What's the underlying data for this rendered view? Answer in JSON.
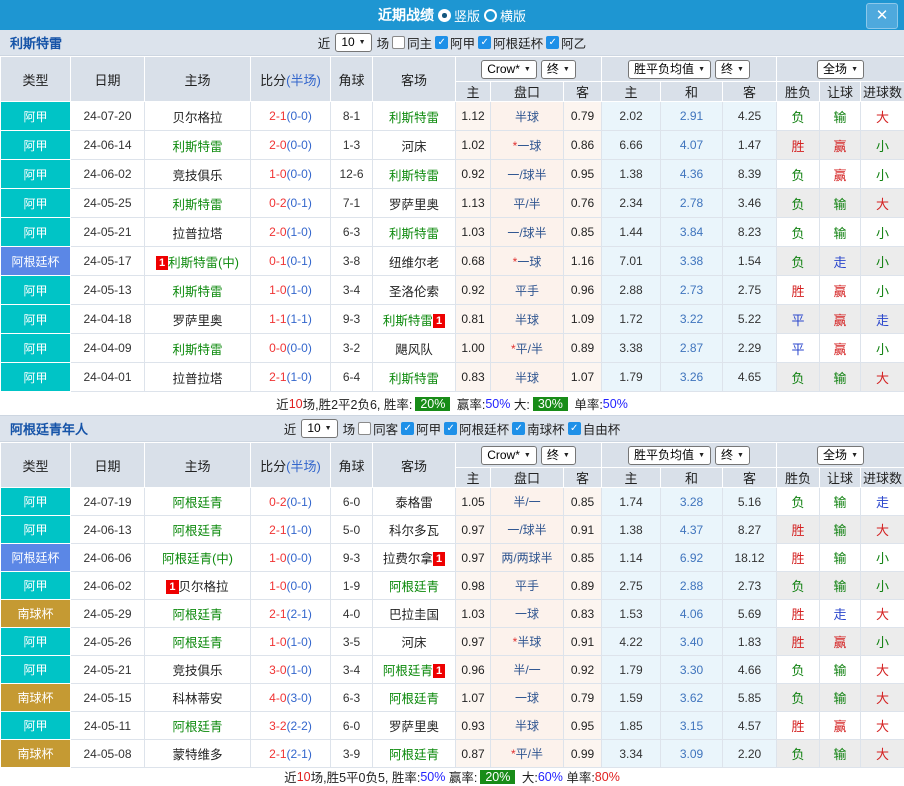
{
  "topbar": {
    "title": "近期战绩",
    "radios": [
      {
        "label": "竖版",
        "selected": true
      },
      {
        "label": "横版",
        "selected": false
      }
    ],
    "close_glyph": "✕"
  },
  "header": {
    "left": [
      "类型",
      "日期",
      "主场",
      "比分",
      "角球",
      "客场"
    ],
    "score_suffix": "(半场)",
    "subs": [
      "主",
      "盘口",
      "客",
      "主",
      "和",
      "客",
      "胜负",
      "让球",
      "进球数"
    ],
    "groups": [
      [
        "Crow*",
        "终"
      ],
      [
        "胜平负均值",
        "终"
      ],
      [
        "全场"
      ]
    ]
  },
  "colors": {
    "topbar_blue": "#1e96d2",
    "league_cyan": "#00c4c6",
    "league_blue": "#5b87e6",
    "league_gold": "#c59a33",
    "badge_green": "#188c18",
    "badge_red": "#ee0000"
  },
  "sections": [
    {
      "team": "利斯特雷",
      "filter": {
        "near": "近",
        "count": "10",
        "unit": "场",
        "checks": [
          {
            "label": "同主",
            "checked": false
          },
          {
            "label": "阿甲",
            "checked": true
          },
          {
            "label": "阿根廷杯",
            "checked": true
          },
          {
            "label": "阿乙",
            "checked": true
          }
        ]
      },
      "rows": [
        {
          "type": "阿甲",
          "tc": "cyan",
          "date": "24-07-20",
          "home": {
            "n": "贝尔格拉"
          },
          "score": "2-1",
          "half": "(0-0)",
          "corner": "8-1",
          "away": {
            "n": "利斯特雷",
            "g": true
          },
          "oh": "1.12",
          "star": false,
          "hc": "半球",
          "oa": "0.79",
          "ah": "2.02",
          "ad": "2.91",
          "aa": "4.25",
          "res": [
            [
              "负",
              "g"
            ],
            [
              "输",
              "g"
            ],
            [
              "大",
              "r"
            ]
          ]
        },
        {
          "type": "阿甲",
          "tc": "cyan",
          "date": "24-06-14",
          "home": {
            "n": "利斯特雷",
            "g": true
          },
          "score": "2-0",
          "half": "(0-0)",
          "corner": "1-3",
          "away": {
            "n": "河床"
          },
          "oh": "1.02",
          "star": true,
          "hc": "一球",
          "oa": "0.86",
          "ah": "6.66",
          "ad": "4.07",
          "aa": "1.47",
          "res": [
            [
              "胜",
              "r"
            ],
            [
              "赢",
              "r"
            ],
            [
              "小",
              "g"
            ]
          ]
        },
        {
          "type": "阿甲",
          "tc": "cyan",
          "date": "24-06-02",
          "home": {
            "n": "竞技俱乐"
          },
          "score": "1-0",
          "half": "(0-0)",
          "corner": "12-6",
          "away": {
            "n": "利斯特雷",
            "g": true
          },
          "oh": "0.92",
          "star": false,
          "hc": "一/球半",
          "oa": "0.95",
          "ah": "1.38",
          "ad": "4.36",
          "aa": "8.39",
          "res": [
            [
              "负",
              "g"
            ],
            [
              "赢",
              "r"
            ],
            [
              "小",
              "g"
            ]
          ]
        },
        {
          "type": "阿甲",
          "tc": "cyan",
          "date": "24-05-25",
          "home": {
            "n": "利斯特雷",
            "g": true
          },
          "score": "0-2",
          "half": "(0-1)",
          "corner": "7-1",
          "away": {
            "n": "罗萨里奥"
          },
          "oh": "1.13",
          "star": false,
          "hc": "平/半",
          "oa": "0.76",
          "ah": "2.34",
          "ad": "2.78",
          "aa": "3.46",
          "res": [
            [
              "负",
              "g"
            ],
            [
              "输",
              "g"
            ],
            [
              "大",
              "r"
            ]
          ]
        },
        {
          "type": "阿甲",
          "tc": "cyan",
          "date": "24-05-21",
          "home": {
            "n": "拉普拉塔"
          },
          "score": "2-0",
          "half": "(1-0)",
          "corner": "6-3",
          "away": {
            "n": "利斯特雷",
            "g": true
          },
          "oh": "1.03",
          "star": false,
          "hc": "一/球半",
          "oa": "0.85",
          "ah": "1.44",
          "ad": "3.84",
          "aa": "8.23",
          "res": [
            [
              "负",
              "g"
            ],
            [
              "输",
              "g"
            ],
            [
              "小",
              "g"
            ]
          ]
        },
        {
          "type": "阿根廷杯",
          "tc": "blue",
          "date": "24-05-17",
          "home": {
            "n": "利斯特雷(中)",
            "g": true,
            "b": "before"
          },
          "score": "0-1",
          "half": "(0-1)",
          "corner": "3-8",
          "away": {
            "n": "纽维尔老"
          },
          "oh": "0.68",
          "star": true,
          "hc": "一球",
          "oa": "1.16",
          "ah": "7.01",
          "ad": "3.38",
          "aa": "1.54",
          "res": [
            [
              "负",
              "g"
            ],
            [
              "走",
              "b"
            ],
            [
              "小",
              "g"
            ]
          ]
        },
        {
          "type": "阿甲",
          "tc": "cyan",
          "date": "24-05-13",
          "home": {
            "n": "利斯特雷",
            "g": true
          },
          "score": "1-0",
          "half": "(1-0)",
          "corner": "3-4",
          "away": {
            "n": "圣洛伦索"
          },
          "oh": "0.92",
          "star": false,
          "hc": "平手",
          "oa": "0.96",
          "ah": "2.88",
          "ad": "2.73",
          "aa": "2.75",
          "res": [
            [
              "胜",
              "r"
            ],
            [
              "赢",
              "r"
            ],
            [
              "小",
              "g"
            ]
          ]
        },
        {
          "type": "阿甲",
          "tc": "cyan",
          "date": "24-04-18",
          "home": {
            "n": "罗萨里奥"
          },
          "score": "1-1",
          "half": "(1-1)",
          "corner": "9-3",
          "away": {
            "n": "利斯特雷",
            "g": true,
            "b": "after"
          },
          "oh": "0.81",
          "star": false,
          "hc": "半球",
          "oa": "1.09",
          "ah": "1.72",
          "ad": "3.22",
          "aa": "5.22",
          "res": [
            [
              "平",
              "b"
            ],
            [
              "赢",
              "r"
            ],
            [
              "走",
              "b"
            ]
          ]
        },
        {
          "type": "阿甲",
          "tc": "cyan",
          "date": "24-04-09",
          "home": {
            "n": "利斯特雷",
            "g": true
          },
          "score": "0-0",
          "half": "(0-0)",
          "corner": "3-2",
          "away": {
            "n": "飓风队"
          },
          "oh": "1.00",
          "star": true,
          "hc": "平/半",
          "oa": "0.89",
          "ah": "3.38",
          "ad": "2.87",
          "aa": "2.29",
          "res": [
            [
              "平",
              "b"
            ],
            [
              "赢",
              "r"
            ],
            [
              "小",
              "g"
            ]
          ]
        },
        {
          "type": "阿甲",
          "tc": "cyan",
          "date": "24-04-01",
          "home": {
            "n": "拉普拉塔"
          },
          "score": "2-1",
          "half": "(1-0)",
          "corner": "6-4",
          "away": {
            "n": "利斯特雷",
            "g": true
          },
          "oh": "0.83",
          "star": false,
          "hc": "半球",
          "oa": "1.07",
          "ah": "1.79",
          "ad": "3.26",
          "aa": "4.65",
          "res": [
            [
              "负",
              "g"
            ],
            [
              "输",
              "g"
            ],
            [
              "大",
              "r"
            ]
          ]
        }
      ],
      "summary": [
        {
          "t": "近"
        },
        {
          "t": "10",
          "s": "red"
        },
        {
          "t": "场,胜2平2负6, 胜率:"
        },
        {
          "t": "20%",
          "s": "badge"
        },
        {
          "t": " 赢率:"
        },
        {
          "t": "50%",
          "s": "blue"
        },
        {
          "t": " 大:"
        },
        {
          "t": "30%",
          "s": "badge"
        },
        {
          "t": " 单率:"
        },
        {
          "t": "50%",
          "s": "blue"
        }
      ]
    },
    {
      "team": "阿根廷青年人",
      "filter": {
        "near": "近",
        "count": "10",
        "unit": "场",
        "checks": [
          {
            "label": "同客",
            "checked": false
          },
          {
            "label": "阿甲",
            "checked": true
          },
          {
            "label": "阿根廷杯",
            "checked": true
          },
          {
            "label": "南球杯",
            "checked": true
          },
          {
            "label": "自由杯",
            "checked": true
          }
        ]
      },
      "rows": [
        {
          "type": "阿甲",
          "tc": "cyan",
          "date": "24-07-19",
          "home": {
            "n": "阿根廷青",
            "g": true
          },
          "score": "0-2",
          "half": "(0-1)",
          "corner": "6-0",
          "away": {
            "n": "泰格雷"
          },
          "oh": "1.05",
          "star": false,
          "hc": "半/一",
          "oa": "0.85",
          "ah": "1.74",
          "ad": "3.28",
          "aa": "5.16",
          "res": [
            [
              "负",
              "g"
            ],
            [
              "输",
              "g"
            ],
            [
              "走",
              "b"
            ]
          ]
        },
        {
          "type": "阿甲",
          "tc": "cyan",
          "date": "24-06-13",
          "home": {
            "n": "阿根廷青",
            "g": true
          },
          "score": "2-1",
          "half": "(1-0)",
          "corner": "5-0",
          "away": {
            "n": "科尔多瓦"
          },
          "oh": "0.97",
          "star": false,
          "hc": "一/球半",
          "oa": "0.91",
          "ah": "1.38",
          "ad": "4.37",
          "aa": "8.27",
          "res": [
            [
              "胜",
              "r"
            ],
            [
              "输",
              "g"
            ],
            [
              "大",
              "r"
            ]
          ]
        },
        {
          "type": "阿根廷杯",
          "tc": "blue",
          "date": "24-06-06",
          "home": {
            "n": "阿根廷青(中)",
            "g": true
          },
          "score": "1-0",
          "half": "(0-0)",
          "corner": "9-3",
          "away": {
            "n": "拉费尔拿",
            "b": "after"
          },
          "oh": "0.97",
          "star": false,
          "hc": "两/两球半",
          "oa": "0.85",
          "ah": "1.14",
          "ad": "6.92",
          "aa": "18.12",
          "res": [
            [
              "胜",
              "r"
            ],
            [
              "输",
              "g"
            ],
            [
              "小",
              "g"
            ]
          ]
        },
        {
          "type": "阿甲",
          "tc": "cyan",
          "date": "24-06-02",
          "home": {
            "n": "贝尔格拉",
            "b": "before"
          },
          "score": "1-0",
          "half": "(0-0)",
          "corner": "1-9",
          "away": {
            "n": "阿根廷青",
            "g": true
          },
          "oh": "0.98",
          "star": false,
          "hc": "平手",
          "oa": "0.89",
          "ah": "2.75",
          "ad": "2.88",
          "aa": "2.73",
          "res": [
            [
              "负",
              "g"
            ],
            [
              "输",
              "g"
            ],
            [
              "小",
              "g"
            ]
          ]
        },
        {
          "type": "南球杯",
          "tc": "gold",
          "date": "24-05-29",
          "home": {
            "n": "阿根廷青",
            "g": true
          },
          "score": "2-1",
          "half": "(2-1)",
          "corner": "4-0",
          "away": {
            "n": "巴拉圭国"
          },
          "oh": "1.03",
          "star": false,
          "hc": "一球",
          "oa": "0.83",
          "ah": "1.53",
          "ad": "4.06",
          "aa": "5.69",
          "res": [
            [
              "胜",
              "r"
            ],
            [
              "走",
              "b"
            ],
            [
              "大",
              "r"
            ]
          ]
        },
        {
          "type": "阿甲",
          "tc": "cyan",
          "date": "24-05-26",
          "home": {
            "n": "阿根廷青",
            "g": true
          },
          "score": "1-0",
          "half": "(1-0)",
          "corner": "3-5",
          "away": {
            "n": "河床"
          },
          "oh": "0.97",
          "star": true,
          "hc": "半球",
          "oa": "0.91",
          "ah": "4.22",
          "ad": "3.40",
          "aa": "1.83",
          "res": [
            [
              "胜",
              "r"
            ],
            [
              "赢",
              "r"
            ],
            [
              "小",
              "g"
            ]
          ]
        },
        {
          "type": "阿甲",
          "tc": "cyan",
          "date": "24-05-21",
          "home": {
            "n": "竞技俱乐"
          },
          "score": "3-0",
          "half": "(1-0)",
          "corner": "3-4",
          "away": {
            "n": "阿根廷青",
            "g": true,
            "b": "after"
          },
          "oh": "0.96",
          "star": false,
          "hc": "半/一",
          "oa": "0.92",
          "ah": "1.79",
          "ad": "3.30",
          "aa": "4.66",
          "res": [
            [
              "负",
              "g"
            ],
            [
              "输",
              "g"
            ],
            [
              "大",
              "r"
            ]
          ]
        },
        {
          "type": "南球杯",
          "tc": "gold",
          "date": "24-05-15",
          "home": {
            "n": "科林蒂安"
          },
          "score": "4-0",
          "half": "(3-0)",
          "corner": "6-3",
          "away": {
            "n": "阿根廷青",
            "g": true
          },
          "oh": "1.07",
          "star": false,
          "hc": "一球",
          "oa": "0.79",
          "ah": "1.59",
          "ad": "3.62",
          "aa": "5.85",
          "res": [
            [
              "负",
              "g"
            ],
            [
              "输",
              "g"
            ],
            [
              "大",
              "r"
            ]
          ]
        },
        {
          "type": "阿甲",
          "tc": "cyan",
          "date": "24-05-11",
          "home": {
            "n": "阿根廷青",
            "g": true
          },
          "score": "3-2",
          "half": "(2-2)",
          "corner": "6-0",
          "away": {
            "n": "罗萨里奥"
          },
          "oh": "0.93",
          "star": false,
          "hc": "半球",
          "oa": "0.95",
          "ah": "1.85",
          "ad": "3.15",
          "aa": "4.57",
          "res": [
            [
              "胜",
              "r"
            ],
            [
              "赢",
              "r"
            ],
            [
              "大",
              "r"
            ]
          ]
        },
        {
          "type": "南球杯",
          "tc": "gold",
          "date": "24-05-08",
          "home": {
            "n": "蒙特维多"
          },
          "score": "2-1",
          "half": "(2-1)",
          "corner": "3-9",
          "away": {
            "n": "阿根廷青",
            "g": true
          },
          "oh": "0.87",
          "star": true,
          "hc": "平/半",
          "oa": "0.99",
          "ah": "3.34",
          "ad": "3.09",
          "aa": "2.20",
          "res": [
            [
              "负",
              "g"
            ],
            [
              "输",
              "g"
            ],
            [
              "大",
              "r"
            ]
          ]
        }
      ],
      "summary": [
        {
          "t": "近"
        },
        {
          "t": "10",
          "s": "red"
        },
        {
          "t": "场,胜5平0负5, 胜率:"
        },
        {
          "t": "50%",
          "s": "blue"
        },
        {
          "t": " 赢率:"
        },
        {
          "t": "20%",
          "s": "badge"
        },
        {
          "t": " 大:"
        },
        {
          "t": "60%",
          "s": "blue"
        },
        {
          "t": " 单率:"
        },
        {
          "t": "80%",
          "s": "red"
        }
      ]
    }
  ]
}
